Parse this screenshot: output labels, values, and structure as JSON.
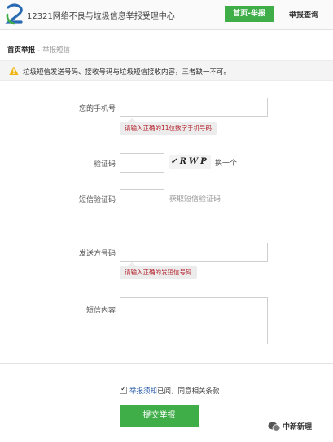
{
  "header": {
    "title": "12321网络不良与垃圾信息举报受理中心",
    "nav_home": "首页-举报",
    "nav_query": "举报查询",
    "colors": {
      "accent": "#3fae49",
      "logo_blue": "#2a6ab3",
      "logo_green": "#3fae49"
    }
  },
  "breadcrumb": {
    "home": "首页举报",
    "separator": "-",
    "current": "举报短信"
  },
  "notice": {
    "icon": "warning-icon",
    "text": "垃圾短信发送号码、接收号码与垃圾短信接收内容，三者缺一不可。"
  },
  "form": {
    "phone": {
      "label": "您的手机号",
      "value": "",
      "tip": "请输入正确的11位数字手机号码"
    },
    "captcha": {
      "label": "验证码",
      "value": "",
      "image_text": "✓RWP",
      "refresh": "换一个"
    },
    "sms_code": {
      "label": "短信验证码",
      "value": "",
      "get_code": "获取短信验证码"
    },
    "sender": {
      "label": "发送方号码",
      "value": "",
      "tip": "请输入正确的发短信号码"
    },
    "content": {
      "label": "短信内容",
      "value": ""
    }
  },
  "agreement": {
    "checked": true,
    "link": "举报须知",
    "text": "已阅，同意相关条款"
  },
  "submit_label": "提交举报",
  "watermark": {
    "icon": "wechat-icon",
    "text": "中新新理"
  }
}
